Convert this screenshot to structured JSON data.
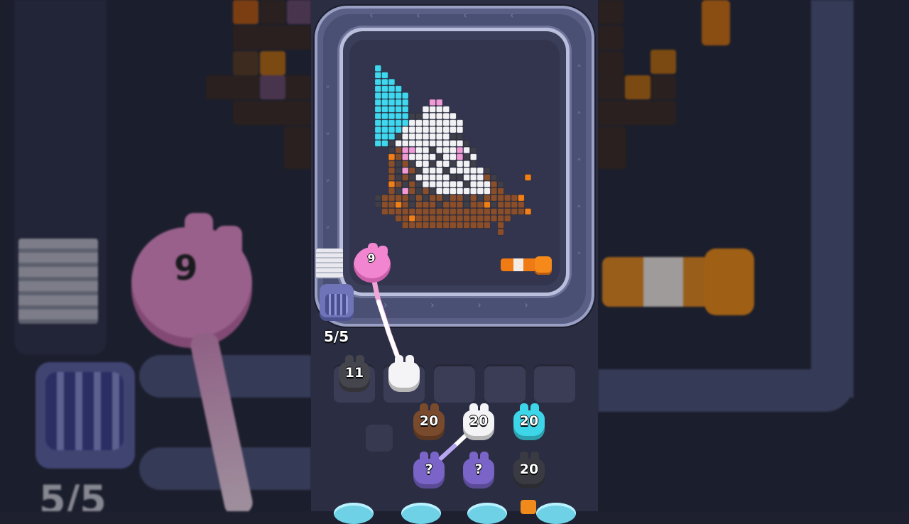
{
  "hud": {
    "capacity": "5/5"
  },
  "launcher": {
    "ammo": "9",
    "color": "#f285d0"
  },
  "palette": {
    "C": "#3fd8ee",
    "W": "#f2f2f4",
    "K": "#3e3f48",
    "P": "#f09ad6",
    "B": "#8a4f2a",
    "O": "#f27f16"
  },
  "pixel_art": [
    "C.......................",
    "CC......................",
    "CCC.....................",
    "CCCC....................",
    "CCCCC...................",
    "CCCCC...PP..............",
    "CCCCC..WWWW.............",
    "CCCCCKKWWWWW............",
    "CCCCCWWWWWWWW...........",
    "CCCCWWWWWWWWW...........",
    "CCCKWWWWWWWKK...........",
    "CCKWWWWWWWWWWK..........",
    "..KBPPWWKWWWPWK.........",
    "..OBPWWWWKWWPKW.........",
    "..BKBKWWKWWKWWK.........",
    "..BKPBKWWWKWWWWWK.......",
    "..BKBKWWWWWKKWWWBK....O.",
    "..OBKBKWWWWWWKWWWBK.....",
    "..BKPBKBKWWWWWWWWBB.....",
    "KBBBBKBKBBKBBKBKBBBBBO..",
    "KBBOBKBBBKBBBKBBOKBBBB..",
    ".BBBBBBBBBBBBBBBBBBBBBO.",
    "...BBOBBBBBBBBBBBBBB....",
    "....BBBBBBBBBBBBB.B.....",
    "..................B....."
  ],
  "conveyor_slots": [
    {
      "label": "11",
      "color": "#44454d",
      "filled": true
    },
    {
      "label": "",
      "color": "#f4f4f6",
      "filled": true
    },
    {
      "label": "",
      "color": "",
      "filled": false
    },
    {
      "label": "",
      "color": "",
      "filled": false
    },
    {
      "label": "",
      "color": "",
      "filled": false
    }
  ],
  "queue": {
    "row1": [
      {
        "label": "20",
        "color": "#7a4a2c"
      },
      {
        "label": "20",
        "color": "#f4f4f6"
      },
      {
        "label": "20",
        "color": "#3cd6e8"
      }
    ],
    "row2": [
      {
        "label": "?",
        "color": "#7a64c8"
      },
      {
        "label": "?",
        "color": "#7a64c8"
      },
      {
        "label": "20",
        "color": "#3a3b42"
      }
    ]
  },
  "background": {
    "left_counter": "5/5",
    "left_ammo": "9"
  }
}
